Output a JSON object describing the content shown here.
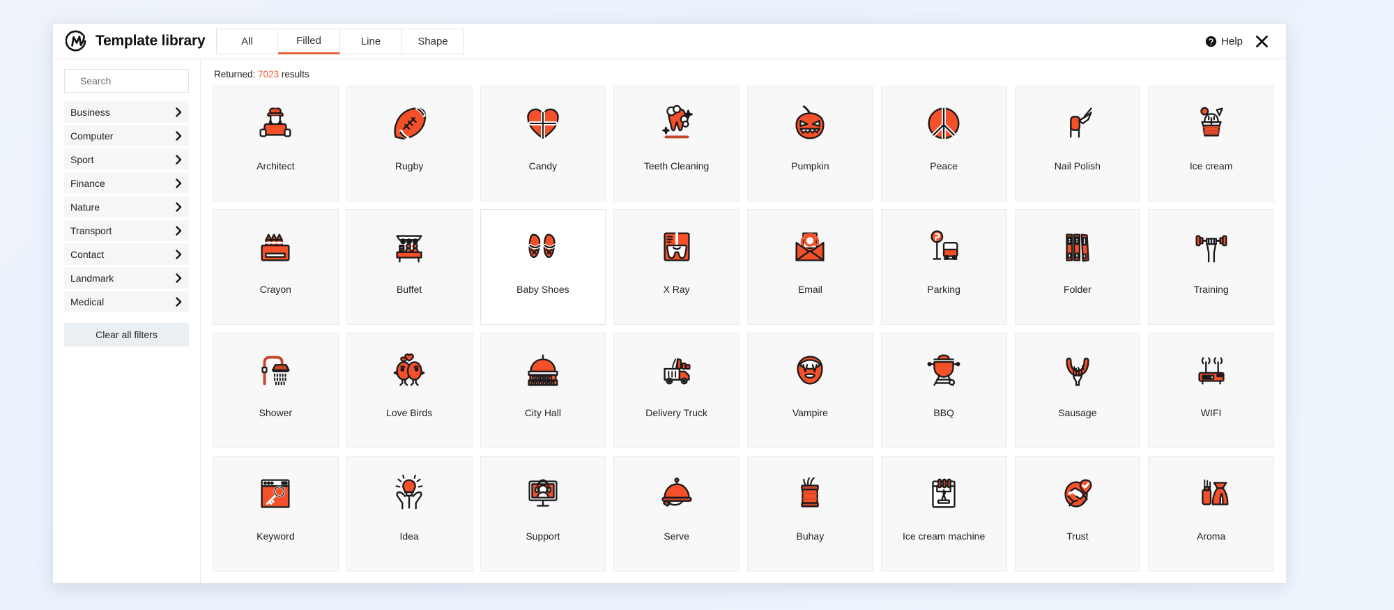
{
  "header": {
    "brand_title": "Template library",
    "logo_icon": "monogram-m-icon",
    "tabs": [
      {
        "label": "All",
        "active": false
      },
      {
        "label": "Filled",
        "active": true
      },
      {
        "label": "Line",
        "active": false
      },
      {
        "label": "Shape",
        "active": false
      }
    ],
    "help_label": "Help",
    "help_icon": "help-circle-icon",
    "close_icon": "close-x-icon"
  },
  "sidebar": {
    "search": {
      "placeholder": "Search",
      "value": ""
    },
    "categories": [
      {
        "label": "Business"
      },
      {
        "label": "Computer"
      },
      {
        "label": "Sport"
      },
      {
        "label": "Finance"
      },
      {
        "label": "Nature"
      },
      {
        "label": "Transport"
      },
      {
        "label": "Contact"
      },
      {
        "label": "Landmark"
      },
      {
        "label": "Medical"
      }
    ],
    "chevron_icon": "chevron-right-icon",
    "clear_filters_label": "Clear all filters"
  },
  "content": {
    "returned_prefix": "Returned: ",
    "returned_count": "7023",
    "returned_suffix": " results",
    "accent_color": "#e8603c",
    "icon_fill_color": "#f4502a",
    "icon_stroke_color": "#1a1a1a",
    "results": [
      {
        "label": "Architect",
        "icon": "architect-icon",
        "hover": false
      },
      {
        "label": "Rugby",
        "icon": "rugby-ball-icon",
        "hover": false
      },
      {
        "label": "Candy",
        "icon": "candy-heart-icon",
        "hover": false
      },
      {
        "label": "Teeth Cleaning",
        "icon": "teeth-cleaning-icon",
        "hover": false
      },
      {
        "label": "Pumpkin",
        "icon": "pumpkin-icon",
        "hover": false
      },
      {
        "label": "Peace",
        "icon": "peace-sign-icon",
        "hover": false
      },
      {
        "label": "Nail Polish",
        "icon": "nail-polish-icon",
        "hover": false
      },
      {
        "label": "Ice cream",
        "icon": "ice-cream-sundae-icon",
        "hover": false
      },
      {
        "label": "Crayon",
        "icon": "crayon-box-icon",
        "hover": false
      },
      {
        "label": "Buffet",
        "icon": "buffet-table-icon",
        "hover": false
      },
      {
        "label": "Baby Shoes",
        "icon": "baby-shoes-icon",
        "hover": true
      },
      {
        "label": "X Ray",
        "icon": "x-ray-icon",
        "hover": false
      },
      {
        "label": "Email",
        "icon": "email-envelope-icon",
        "hover": false
      },
      {
        "label": "Parking",
        "icon": "parking-sign-car-icon",
        "hover": false
      },
      {
        "label": "Folder",
        "icon": "binder-folder-icon",
        "hover": false
      },
      {
        "label": "Training",
        "icon": "dumbbell-hand-icon",
        "hover": false
      },
      {
        "label": "Shower",
        "icon": "shower-head-icon",
        "hover": false
      },
      {
        "label": "Love Birds",
        "icon": "love-birds-icon",
        "hover": false
      },
      {
        "label": "City Hall",
        "icon": "city-hall-icon",
        "hover": false
      },
      {
        "label": "Delivery Truck",
        "icon": "delivery-truck-icon",
        "hover": false
      },
      {
        "label": "Vampire",
        "icon": "vampire-mouth-icon",
        "hover": false
      },
      {
        "label": "BBQ",
        "icon": "bbq-grill-icon",
        "hover": false
      },
      {
        "label": "Sausage",
        "icon": "sausage-fork-icon",
        "hover": false
      },
      {
        "label": "WIFI",
        "icon": "wifi-router-icon",
        "hover": false
      },
      {
        "label": "Keyword",
        "icon": "keyword-browser-key-icon",
        "hover": false
      },
      {
        "label": "Idea",
        "icon": "idea-bulb-hands-icon",
        "hover": false
      },
      {
        "label": "Support",
        "icon": "support-headset-icon",
        "hover": false
      },
      {
        "label": "Serve",
        "icon": "serve-cloche-icon",
        "hover": false
      },
      {
        "label": "Buhay",
        "icon": "buhay-can-icon",
        "hover": false
      },
      {
        "label": "Ice cream machine",
        "icon": "ice-cream-machine-icon",
        "hover": false
      },
      {
        "label": "Trust",
        "icon": "trust-handshake-icon",
        "hover": false
      },
      {
        "label": "Aroma",
        "icon": "aroma-diffuser-icon",
        "hover": false
      }
    ]
  }
}
